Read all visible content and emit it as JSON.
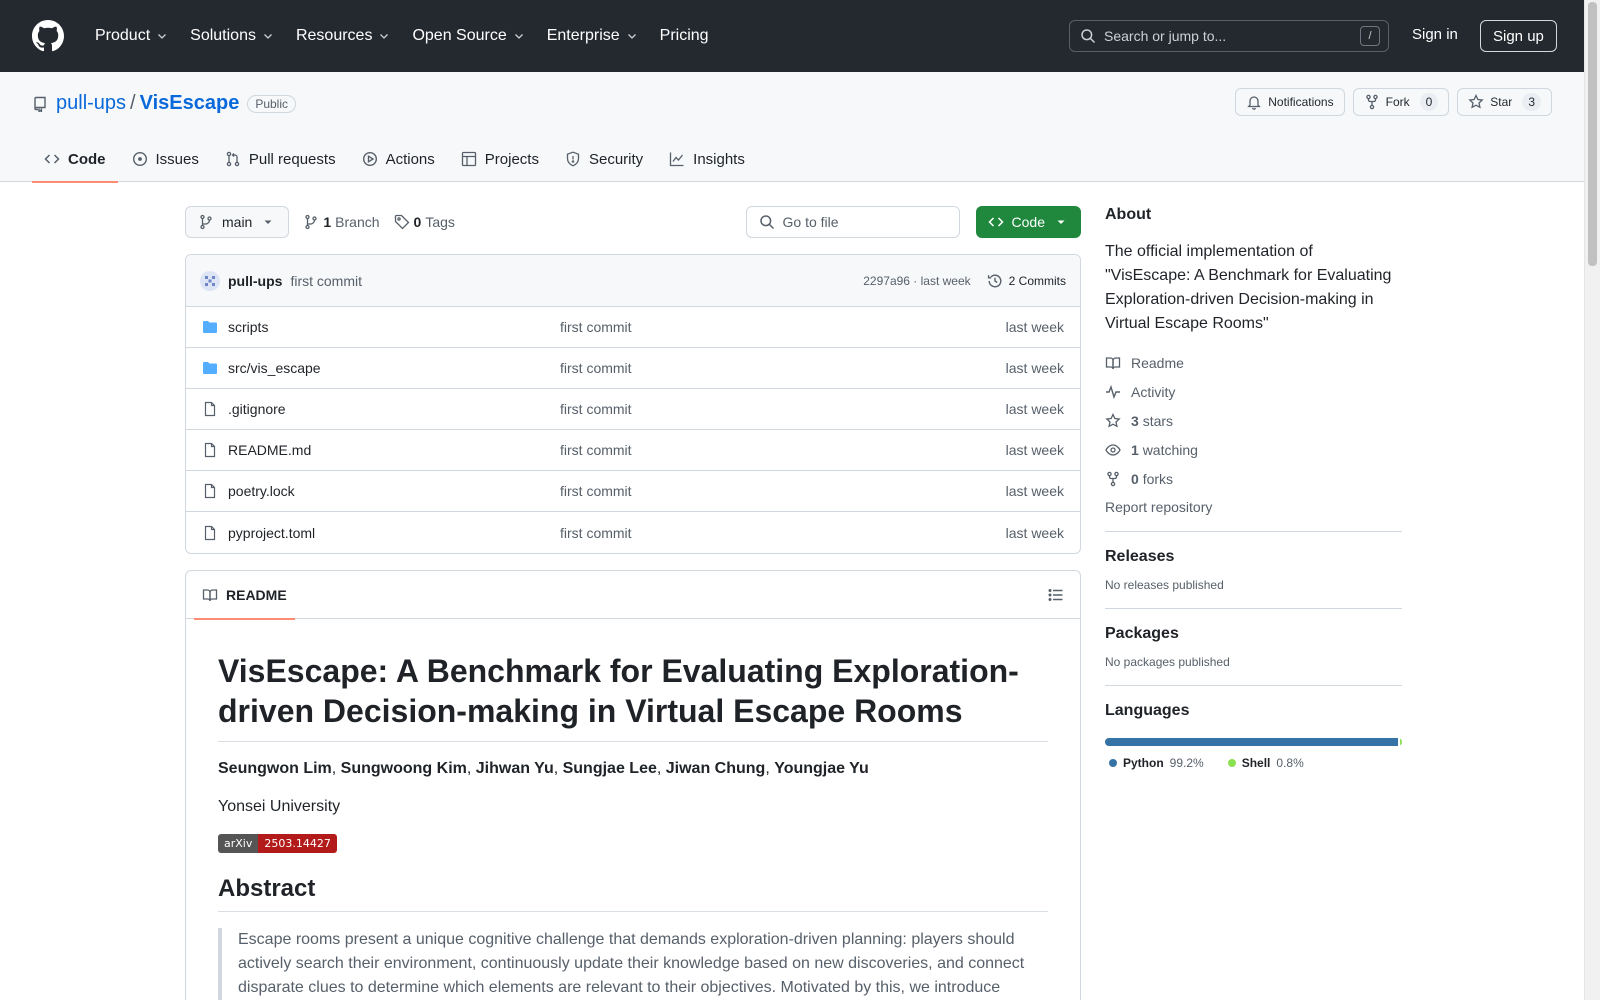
{
  "header": {
    "nav": [
      {
        "label": "Product",
        "dropdown": true
      },
      {
        "label": "Solutions",
        "dropdown": true
      },
      {
        "label": "Resources",
        "dropdown": true
      },
      {
        "label": "Open Source",
        "dropdown": true
      },
      {
        "label": "Enterprise",
        "dropdown": true
      },
      {
        "label": "Pricing",
        "dropdown": false
      }
    ],
    "search_placeholder": "Search or jump to...",
    "search_shortcut": "/",
    "sign_in": "Sign in",
    "sign_up": "Sign up"
  },
  "repo": {
    "owner": "pull-ups",
    "separator": "/",
    "name": "VisEscape",
    "visibility": "Public",
    "notifications_label": "Notifications",
    "fork_label": "Fork",
    "fork_count": "0",
    "star_label": "Star",
    "star_count": "3"
  },
  "tabs": [
    {
      "label": "Code",
      "icon": "code-icon",
      "active": true
    },
    {
      "label": "Issues",
      "icon": "issue-icon",
      "active": false
    },
    {
      "label": "Pull requests",
      "icon": "pull-request-icon",
      "active": false
    },
    {
      "label": "Actions",
      "icon": "play-icon",
      "active": false
    },
    {
      "label": "Projects",
      "icon": "table-icon",
      "active": false
    },
    {
      "label": "Security",
      "icon": "shield-icon",
      "active": false
    },
    {
      "label": "Insights",
      "icon": "graph-icon",
      "active": false
    }
  ],
  "toolbar": {
    "branch": "main",
    "branch_count": "1",
    "branch_label": "Branch",
    "tag_count": "0",
    "tag_label": "Tags",
    "goto_placeholder": "Go to file",
    "code_label": "Code"
  },
  "latest_commit": {
    "author": "pull-ups",
    "message": "first commit",
    "hash_time": "2297a96 · last week",
    "commits_label": "2 Commits"
  },
  "files": [
    {
      "name": "scripts",
      "type": "folder",
      "message": "first commit",
      "date": "last week"
    },
    {
      "name": "src/vis_escape",
      "type": "folder",
      "message": "first commit",
      "date": "last week"
    },
    {
      "name": ".gitignore",
      "type": "file",
      "message": "first commit",
      "date": "last week"
    },
    {
      "name": "README.md",
      "type": "file",
      "message": "first commit",
      "date": "last week"
    },
    {
      "name": "poetry.lock",
      "type": "file",
      "message": "first commit",
      "date": "last week"
    },
    {
      "name": "pyproject.toml",
      "type": "file",
      "message": "first commit",
      "date": "last week"
    }
  ],
  "readme": {
    "tab_label": "README",
    "title": "VisEscape: A Benchmark for Evaluating Exploration-driven Decision-making in Virtual Escape Rooms",
    "authors": [
      "Seungwon Lim",
      "Sungwoong Kim",
      "Jihwan Yu",
      "Sungjae Lee",
      "Jiwan Chung",
      "Youngjae Yu"
    ],
    "affiliation": "Yonsei University",
    "badge_left": "arXiv",
    "badge_right": "2503.14427",
    "abstract_heading": "Abstract",
    "abstract_text": "Escape rooms present a unique cognitive challenge that demands exploration-driven planning: players should actively search their environment, continuously update their knowledge based on new discoveries, and connect disparate clues to determine which elements are relevant to their objectives. Motivated by this, we introduce"
  },
  "sidebar": {
    "about_heading": "About",
    "description": "The official implementation of \"VisEscape: A Benchmark for Evaluating Exploration-driven Decision-making in Virtual Escape Rooms\"",
    "readme_label": "Readme",
    "activity_label": "Activity",
    "stars_count": "3",
    "stars_label": "stars",
    "watching_count": "1",
    "watching_label": "watching",
    "forks_count": "0",
    "forks_label": "forks",
    "report_label": "Report repository",
    "releases_heading": "Releases",
    "releases_text": "No releases published",
    "packages_heading": "Packages",
    "packages_text": "No packages published",
    "languages_heading": "Languages",
    "languages": [
      {
        "name": "Python",
        "percent": "99.2%",
        "fraction": 0.992,
        "color": "#3572A5"
      },
      {
        "name": "Shell",
        "percent": "0.8%",
        "fraction": 0.008,
        "color": "#89e051"
      }
    ]
  }
}
